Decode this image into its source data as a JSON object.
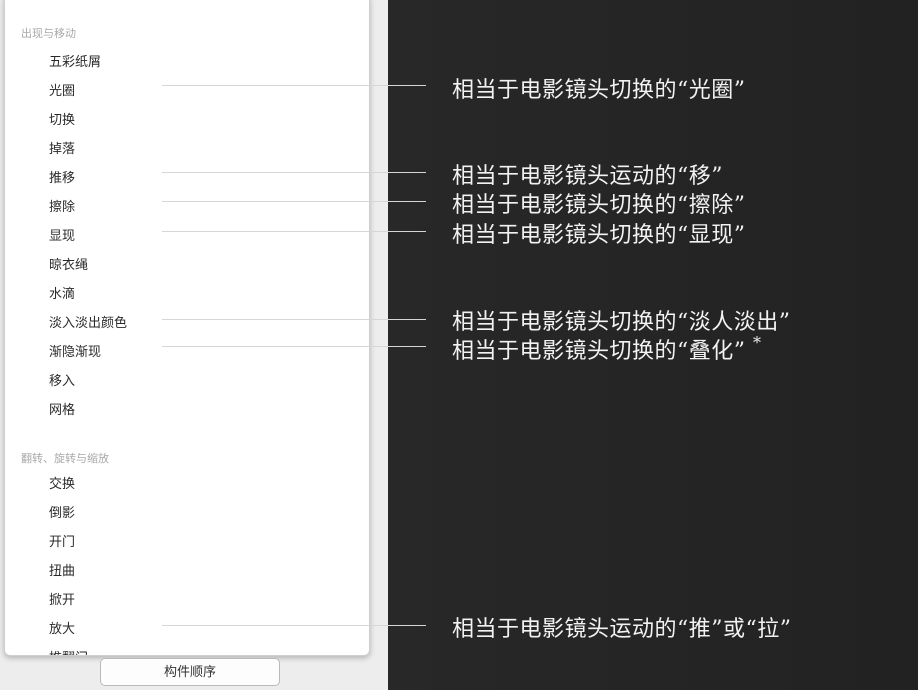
{
  "sidebar": {
    "section1_title": "出现与移动",
    "section2_title": "翻转、旋转与缩放",
    "items": [
      "五彩纸屑",
      "光圈",
      "切换",
      "掉落",
      "推移",
      "擦除",
      "显现",
      "晾衣绳",
      "水滴",
      "淡入淡出颜色",
      "渐隐渐现",
      "移入",
      "网格"
    ],
    "items2": [
      "交换",
      "倒影",
      "开门",
      "扭曲",
      "掀开",
      "放大",
      "推翻门"
    ],
    "order_button": "构件顺序"
  },
  "annotations": [
    "相当于电影镜头切换的“光圈”",
    "相当于电影镜头运动的“移”",
    "相当于电影镜头切换的“擦除”",
    "相当于电影镜头切换的“显现”",
    "相当于电影镜头切换的“淡人淡出”",
    "相当于电影镜头切换的“叠化”",
    "相当于电影镜头运动的“推”或“拉”"
  ],
  "asterisk": "*",
  "colors": {
    "background": "#2a2a2a",
    "panel": "#ffffff",
    "annotation_text": "#f2f2f2",
    "connector": "#d6d6d6"
  }
}
